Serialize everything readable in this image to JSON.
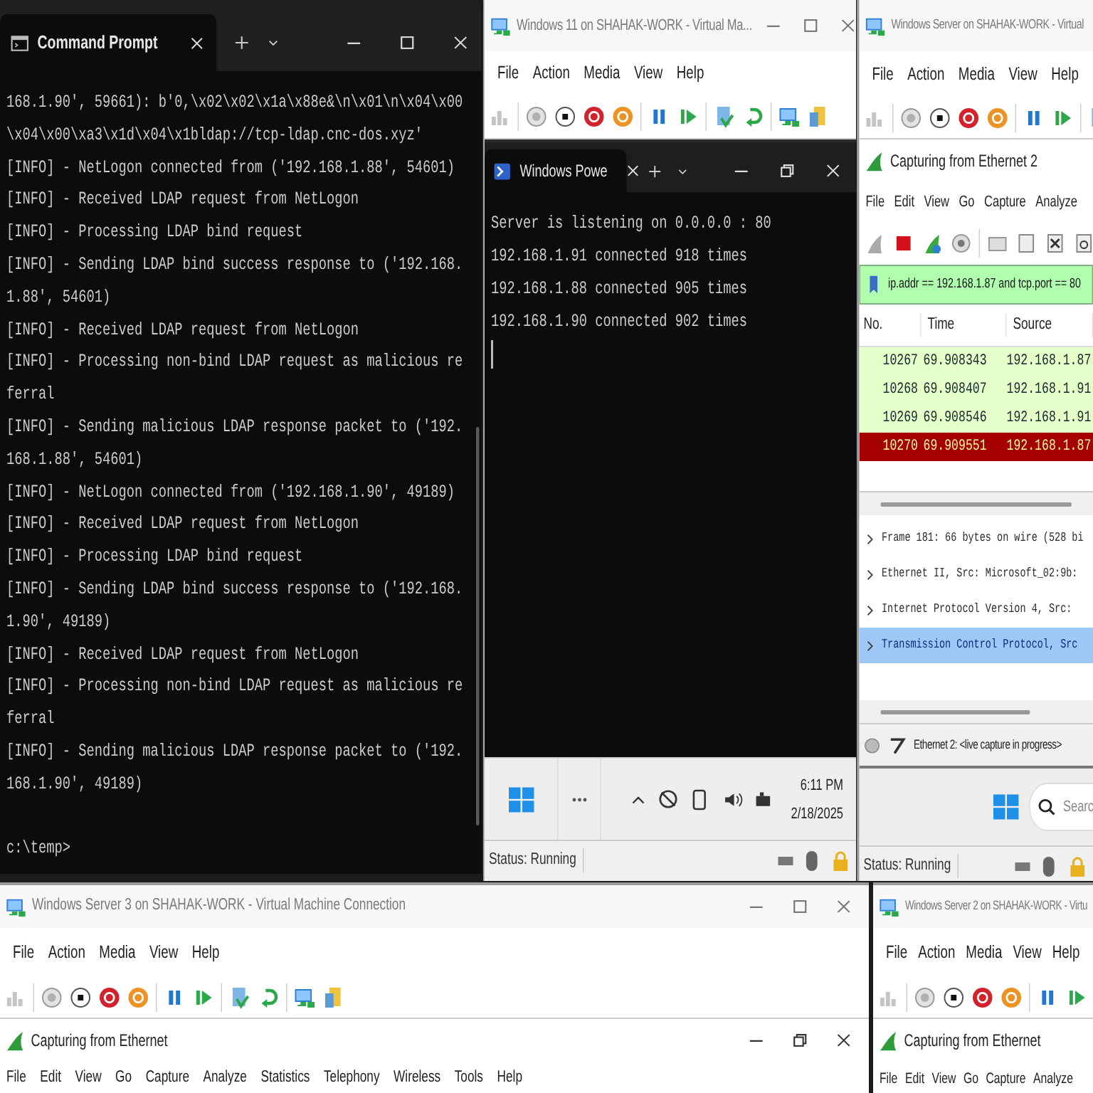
{
  "command_prompt": {
    "tab_title": "Command Prompt",
    "lines": [
      "168.1.90', 59661): b'0,\\x02\\x02\\x1a\\x88e&\\n\\x01\\n\\x04\\x00",
      "\\x04\\x00\\xa3\\x1d\\x04\\x1bldap://tcp-ldap.cnc-dos.xyz'",
      "[INFO] - NetLogon connected from ('192.168.1.88', 54601)",
      "[INFO] - Received LDAP request from NetLogon",
      "[INFO] - Processing LDAP bind request",
      "[INFO] - Sending LDAP bind success response to ('192.168.",
      "1.88', 54601)",
      "[INFO] - Received LDAP request from NetLogon",
      "[INFO] - Processing non-bind LDAP request as malicious re",
      "ferral",
      "[INFO] - Sending malicious LDAP response packet to ('192.",
      "168.1.88', 54601)",
      "[INFO] - NetLogon connected from ('192.168.1.90', 49189)",
      "[INFO] - Received LDAP request from NetLogon",
      "[INFO] - Processing LDAP bind request",
      "[INFO] - Sending LDAP bind success response to ('192.168.",
      "1.90', 49189)",
      "[INFO] - Received LDAP request from NetLogon",
      "[INFO] - Processing non-bind LDAP request as malicious re",
      "ferral",
      "[INFO] - Sending malicious LDAP response packet to ('192.",
      "168.1.90', 49189)"
    ],
    "prompt": "c:\\temp>"
  },
  "windows_11_vm": {
    "title": "Windows 11 on SHAHAK-WORK - Virtual Ma...",
    "menu": [
      "File",
      "Action",
      "Media",
      "View",
      "Help"
    ],
    "powershell": {
      "tab_title": "Windows Powe",
      "lines": [
        "Server is listening on 0.0.0.0 : 80",
        "192.168.1.91 connected 918 times",
        "192.168.1.88 connected 905 times",
        "192.168.1.90 connected 902 times"
      ]
    },
    "taskbar": {
      "time": "6:11 PM",
      "date": "2/18/2025"
    },
    "status": "Status: Running"
  },
  "server_vm": {
    "title": "Windows Server on SHAHAK-WORK - Virtual",
    "menu": [
      "File",
      "Action",
      "Media",
      "View",
      "Help"
    ],
    "wireshark": {
      "title": "Capturing from Ethernet 2",
      "menu": [
        "File",
        "Edit",
        "View",
        "Go",
        "Capture",
        "Analyze"
      ],
      "filter": "ip.addr == 192.168.1.87 and tcp.port == 80",
      "columns": [
        "No.",
        "Time",
        "Source"
      ],
      "packets": [
        {
          "no": "10267",
          "time": "69.908343",
          "source": "192.168.1.87",
          "color": "#e4ffc7"
        },
        {
          "no": "10268",
          "time": "69.908407",
          "source": "192.168.1.91",
          "color": "#e4ffc7"
        },
        {
          "no": "10269",
          "time": "69.908546",
          "source": "192.168.1.91",
          "color": "#e4ffc7"
        },
        {
          "no": "10270",
          "time": "69.909551",
          "source": "192.168.1.87",
          "color": "#a40000"
        }
      ],
      "details": [
        {
          "text": "Frame 181: 66 bytes on wire (528 bi",
          "selected": false
        },
        {
          "text": "Ethernet II, Src: Microsoft_02:9b:",
          "selected": false
        },
        {
          "text": "Internet Protocol Version 4, Src:",
          "selected": false
        },
        {
          "text": "Transmission Control Protocol, Src",
          "selected": true
        }
      ],
      "status": "Ethernet 2: <live capture in progress>"
    },
    "taskbar": {
      "placeholder": "Searc"
    },
    "status": "Status: Running"
  },
  "server_3_vm": {
    "title": "Windows Server 3 on SHAHAK-WORK - Virtual Machine Connection",
    "menu": [
      "File",
      "Action",
      "Media",
      "View",
      "Help"
    ],
    "wireshark": {
      "title": "Capturing from Ethernet",
      "menu": [
        "File",
        "Edit",
        "View",
        "Go",
        "Capture",
        "Analyze",
        "Statistics",
        "Telephony",
        "Wireless",
        "Tools",
        "Help"
      ]
    }
  },
  "server_2_vm": {
    "title": "Windows Server 2 on SHAHAK-WORK - Virtu",
    "menu": [
      "File",
      "Action",
      "Media",
      "View",
      "Help"
    ],
    "wireshark": {
      "title": "Capturing from Ethernet",
      "menu": [
        "File",
        "Edit",
        "View",
        "Go",
        "Capture",
        "Analyze"
      ]
    }
  }
}
